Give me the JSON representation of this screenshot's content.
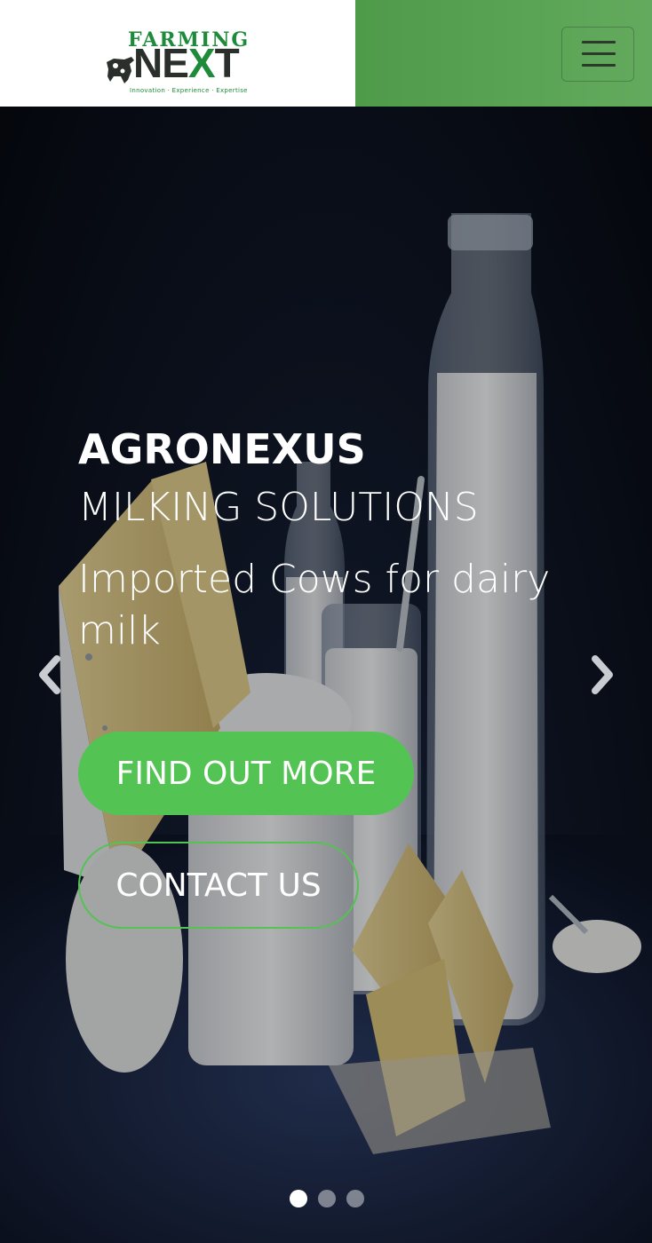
{
  "header": {
    "logo": {
      "top_text": "FARMING",
      "main_text_part1": "NE",
      "main_text_x": "X",
      "main_text_part2": "T",
      "tagline": "Innovation · Experience · Expertise"
    },
    "menu_icon": "hamburger-icon"
  },
  "hero": {
    "title": "AGRONEXUS",
    "subtitle": "MILKING SOLUTIONS",
    "description": "Imported Cows for dairy milk",
    "primary_button": "FIND OUT MORE",
    "secondary_button": "CONTACT US",
    "prev_icon": "chevron-left-icon",
    "next_icon": "chevron-right-icon",
    "slides": {
      "count": 3,
      "active": 1
    }
  },
  "colors": {
    "brand_green": "#53c353",
    "header_green": "#5aa455",
    "logo_green": "#1e8b3a"
  }
}
